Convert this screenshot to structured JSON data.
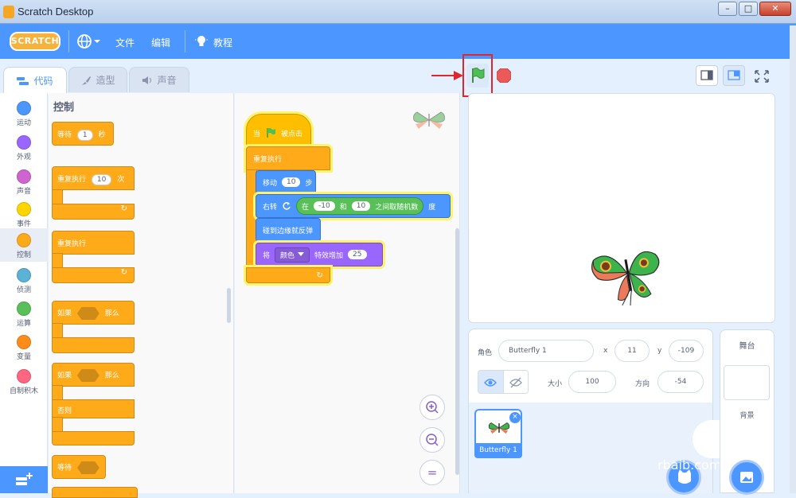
{
  "window": {
    "title": "Scratch Desktop",
    "minimize": "–",
    "maximize": "□",
    "close": "✕"
  },
  "menubar": {
    "logo": "SCRATCH",
    "language_icon": "globe-icon",
    "file": "文件",
    "edit": "编辑",
    "tutorials": "教程"
  },
  "tabs": {
    "code": "代码",
    "costumes": "造型",
    "sounds": "声音"
  },
  "categories": [
    {
      "label": "运动",
      "color": "#4c97ff"
    },
    {
      "label": "外观",
      "color": "#9966ff"
    },
    {
      "label": "声音",
      "color": "#cf63cf"
    },
    {
      "label": "事件",
      "color": "#ffd500"
    },
    {
      "label": "控制",
      "color": "#ffab19"
    },
    {
      "label": "侦测",
      "color": "#5cb1d6"
    },
    {
      "label": "运算",
      "color": "#59c059"
    },
    {
      "label": "变量",
      "color": "#ff8c1a"
    },
    {
      "label": "自制积木",
      "color": "#ff6680"
    }
  ],
  "palette": {
    "title": "控制",
    "wait": {
      "label": "等待",
      "value": "1",
      "unit": "秒"
    },
    "repeat": {
      "label": "重复执行",
      "value": "10",
      "unit": "次"
    },
    "forever": {
      "label": "重复执行"
    },
    "if_then": {
      "if": "如果",
      "then": "那么"
    },
    "if_else": {
      "if": "如果",
      "then": "那么",
      "else": "否则"
    },
    "wait_until": {
      "label": "等待"
    }
  },
  "script": {
    "when_flag_pre": "当",
    "when_flag_post": "被点击",
    "forever": "重复执行",
    "move": {
      "label": "移动",
      "value": "10",
      "unit": "步"
    },
    "turn": {
      "label": "右转",
      "unit": "度"
    },
    "random": {
      "pre": "在",
      "from": "-10",
      "mid": "和",
      "to": "10",
      "post": "之间取随机数"
    },
    "bounce": "碰到边缘就反弹",
    "effect": {
      "pre": "将",
      "effect": "颜色",
      "mid": "特效增加",
      "value": "25"
    }
  },
  "zoom": {
    "in": "+",
    "out": "−",
    "reset": "="
  },
  "sprite_info": {
    "sprite_label": "角色",
    "sprite_name": "Butterfly 1",
    "x_label": "x",
    "x_value": "11",
    "y_label": "y",
    "y_value": "-109",
    "size_label": "大小",
    "size_value": "100",
    "direction_label": "方向",
    "direction_value": "-54"
  },
  "sprite_list": {
    "card_label": "Butterfly 1",
    "delete": "×"
  },
  "stage_pane": {
    "title": "舞台",
    "backdrop_label": "背景"
  },
  "watermark": "rbaib.com"
}
